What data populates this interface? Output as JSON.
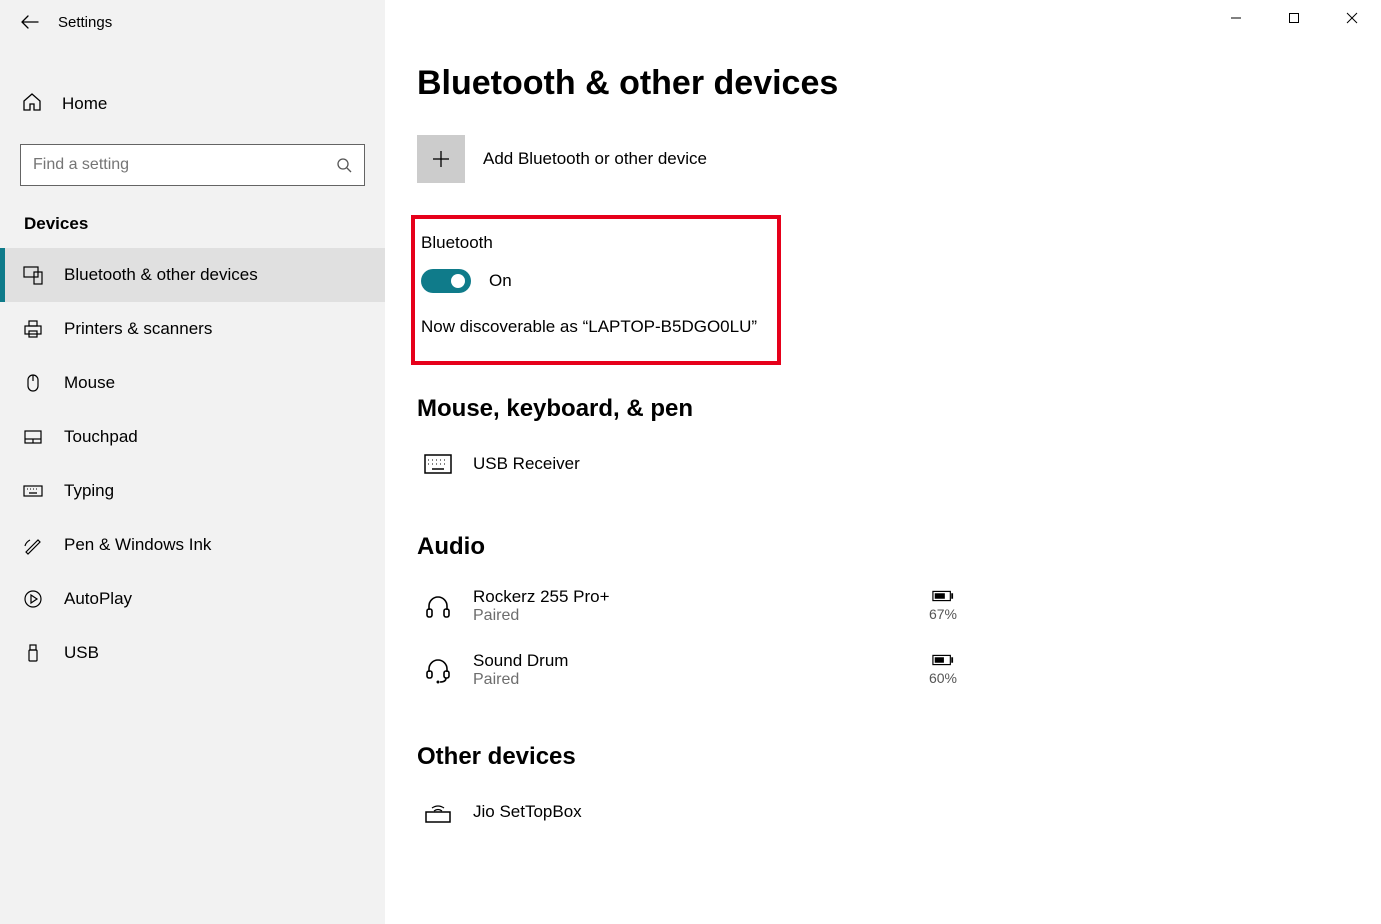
{
  "window": {
    "title": "Settings"
  },
  "sidebar": {
    "home_label": "Home",
    "search_placeholder": "Find a setting",
    "section_label": "Devices",
    "items": [
      {
        "label": "Bluetooth & other devices",
        "icon": "bluetooth-devices",
        "selected": true
      },
      {
        "label": "Printers & scanners",
        "icon": "printer",
        "selected": false
      },
      {
        "label": "Mouse",
        "icon": "mouse",
        "selected": false
      },
      {
        "label": "Touchpad",
        "icon": "touchpad",
        "selected": false
      },
      {
        "label": "Typing",
        "icon": "keyboard",
        "selected": false
      },
      {
        "label": "Pen & Windows Ink",
        "icon": "pen",
        "selected": false
      },
      {
        "label": "AutoPlay",
        "icon": "autoplay",
        "selected": false
      },
      {
        "label": "USB",
        "icon": "usb",
        "selected": false
      }
    ]
  },
  "main": {
    "title": "Bluetooth & other devices",
    "add_device_label": "Add Bluetooth or other device",
    "bluetooth": {
      "label": "Bluetooth",
      "state_label": "On",
      "discoverable_text": "Now discoverable as “LAPTOP-B5DGO0LU”"
    },
    "groups": [
      {
        "heading": "Mouse, keyboard, & pen",
        "devices": [
          {
            "name": "USB Receiver",
            "status": "",
            "icon": "keyboard",
            "battery": ""
          }
        ]
      },
      {
        "heading": "Audio",
        "devices": [
          {
            "name": "Rockerz 255 Pro+",
            "status": "Paired",
            "icon": "headphones",
            "battery": "67%"
          },
          {
            "name": "Sound Drum",
            "status": "Paired",
            "icon": "headset",
            "battery": "60%"
          }
        ]
      },
      {
        "heading": "Other devices",
        "devices": [
          {
            "name": "Jio SetTopBox",
            "status": "",
            "icon": "settop",
            "battery": ""
          }
        ]
      }
    ]
  }
}
